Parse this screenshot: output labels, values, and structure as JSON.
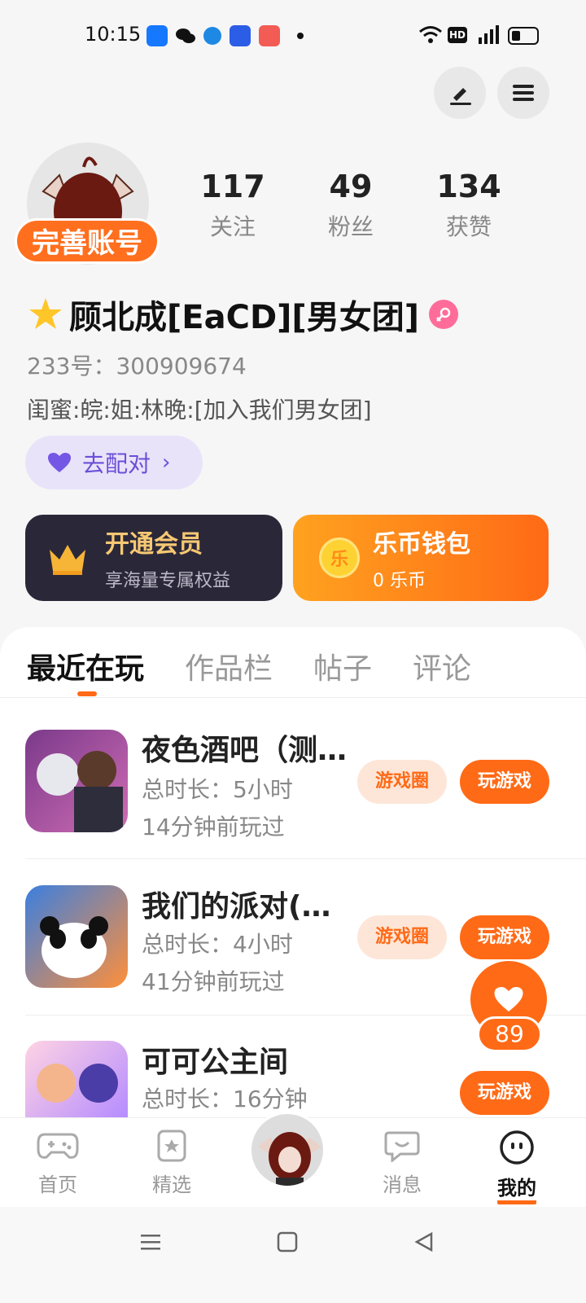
{
  "status_bar": {
    "time": "10:15",
    "app_icons": [
      "alipay-icon",
      "wechat-icon",
      "browser-icon",
      "baidu-icon",
      "music-icon"
    ],
    "network": "4G",
    "hd": "HD"
  },
  "header": {
    "edit_icon": "pen-icon",
    "menu_icon": "hamburger-menu-icon"
  },
  "profile": {
    "complete_label": "完善账号",
    "stats": [
      {
        "value": "117",
        "label": "关注"
      },
      {
        "value": "49",
        "label": "粉丝"
      },
      {
        "value": "134",
        "label": "获赞"
      }
    ],
    "name": "顾北成[EaCD][男女团]",
    "uid": "233号：300909674",
    "bio": "闺蜜:皖:姐:林晚:[加入我们男女团]",
    "match_label": "去配对",
    "vip": {
      "title": "开通会员",
      "subtitle": "享海量专属权益"
    },
    "wallet": {
      "title": "乐币钱包",
      "subtitle": "0 乐币",
      "coin_char": "乐"
    }
  },
  "tabs": [
    "最近在玩",
    "作品栏",
    "帖子",
    "评论"
  ],
  "games": [
    {
      "title": "夜色酒吧（测…",
      "duration": "总时长：5小时",
      "last_played": "14分钟前玩过",
      "circle_label": "游戏圈",
      "play_label": "玩游戏"
    },
    {
      "title": "我们的派对(…",
      "duration": "总时长：4小时",
      "last_played": "41分钟前玩过",
      "circle_label": "游戏圈",
      "play_label": "玩游戏"
    },
    {
      "title": "可可公主间",
      "duration": "总时长：16分钟",
      "last_played": "",
      "circle_label": "",
      "play_label": "玩游戏"
    }
  ],
  "like": {
    "count": "89"
  },
  "bottom_nav": [
    {
      "label": "首页",
      "icon": "gamepad-icon"
    },
    {
      "label": "精选",
      "icon": "star-card-icon"
    },
    {
      "label": "",
      "icon": "avatar-center"
    },
    {
      "label": "消息",
      "icon": "chat-icon"
    },
    {
      "label": "我的",
      "icon": "face-icon"
    }
  ],
  "colors": {
    "accent": "#ff6a16",
    "purple": "#6b4fd8",
    "vip_bg": "#2a2838"
  }
}
